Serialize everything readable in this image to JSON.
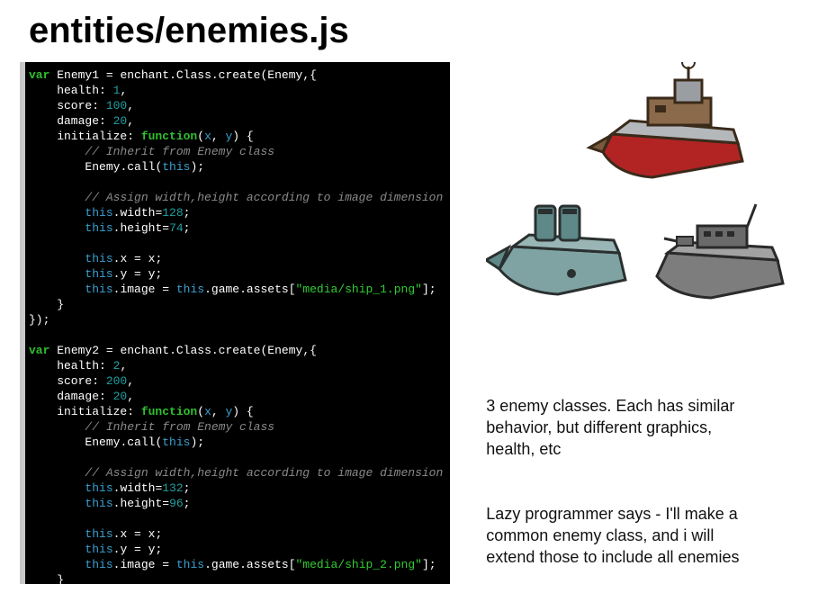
{
  "title": "entities/enemies.js",
  "code": {
    "blocks": [
      {
        "className": "Enemy1",
        "parent": "Enemy",
        "health": "1",
        "score": "100",
        "damage": "20",
        "comment1": "// Inherit from Enemy class",
        "callParent": "Enemy",
        "comment2": "// Assign width,height according to image dimension",
        "width": "128",
        "height": "74",
        "asset": "\"media/ship_1.png\""
      },
      {
        "className": "Enemy2",
        "parent": "Enemy",
        "health": "2",
        "score": "200",
        "damage": "20",
        "comment1": "// Inherit from Enemy class",
        "callParent": "Enemy",
        "comment2": "// Assign width,height according to image dimension",
        "width": "132",
        "height": "96",
        "asset": "\"media/ship_2.png\""
      }
    ]
  },
  "paragraph1": "3 enemy classes. Each has similar behavior, but different graphics, health, etc",
  "paragraph2": "Lazy programmer says - I'll make a common enemy class, and i will extend those to include all enemies"
}
